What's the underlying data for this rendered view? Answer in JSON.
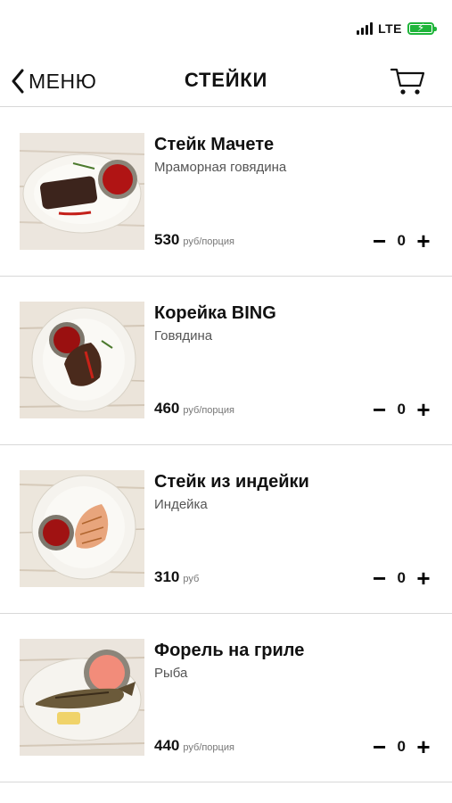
{
  "status_bar": {
    "network": "LTE",
    "battery_color": "#1fb53a"
  },
  "nav": {
    "back_label": "МЕНЮ",
    "title": "СТЕЙКИ",
    "back_icon": "chevron-left-icon",
    "cart_icon": "cart-icon"
  },
  "items": [
    {
      "title": "Стейк Мачете",
      "subtitle": "Мраморная говядина",
      "price": "530",
      "unit": "руб/порция",
      "qty": "0"
    },
    {
      "title": "Корейка BING",
      "subtitle": "Говядина",
      "price": "460",
      "unit": "руб/порция",
      "qty": "0"
    },
    {
      "title": "Стейк из индейки",
      "subtitle": "Индейка",
      "price": "310",
      "unit": "руб",
      "qty": "0"
    },
    {
      "title": "Форель на гриле",
      "subtitle": "Рыба",
      "price": "440",
      "unit": "руб/порция",
      "qty": "0"
    }
  ],
  "stepper": {
    "minus": "−",
    "plus": "+"
  }
}
